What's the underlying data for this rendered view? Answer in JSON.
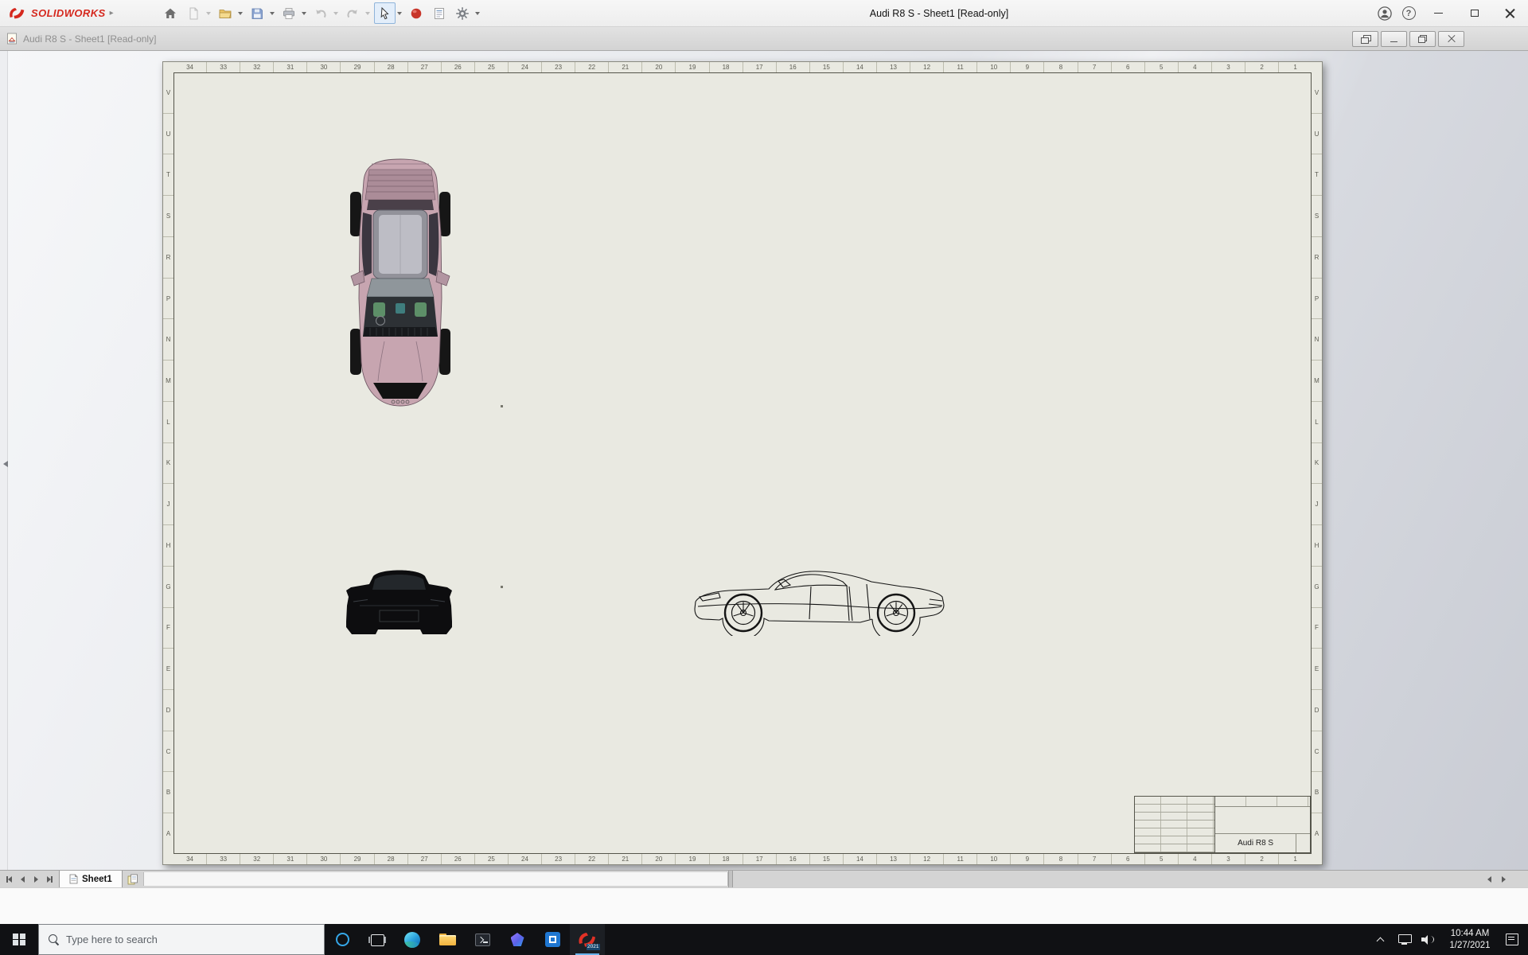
{
  "icons": {
    "brand_chevron": "▸",
    "help_glyph": "?"
  },
  "app": {
    "brand": "SOLIDWORKS",
    "title": "Audi R8 S - Sheet1 [Read-only]"
  },
  "document_window": {
    "title": "Audi R8 S - Sheet1 [Read-only]"
  },
  "drawing": {
    "sheet_name": "Audi R8 S",
    "zone_columns": [
      "34",
      "33",
      "32",
      "31",
      "30",
      "29",
      "28",
      "27",
      "26",
      "25",
      "24",
      "23",
      "22",
      "21",
      "20",
      "19",
      "18",
      "17",
      "16",
      "15",
      "14",
      "13",
      "12",
      "11",
      "10",
      "9",
      "8",
      "7",
      "6",
      "5",
      "4",
      "3",
      "2",
      "1"
    ],
    "zone_rows": [
      "V",
      "U",
      "T",
      "S",
      "R",
      "P",
      "N",
      "M",
      "L",
      "K",
      "J",
      "H",
      "G",
      "F",
      "E",
      "D",
      "C",
      "B",
      "A"
    ],
    "title_block": {
      "part_name": "Audi R8 S"
    }
  },
  "sheet_tabs": {
    "sheet1_label": "Sheet1"
  },
  "taskbar": {
    "search_placeholder": "Type here to search",
    "solidworks_badge": "2021",
    "clock_time": "10:44 AM",
    "clock_date": "1/27/2021"
  },
  "colors": {
    "solidworks_red": "#d5281e",
    "paper": "#e9e9e1",
    "taskbar": "#101114",
    "car_body_pink": "#c7a5b0"
  }
}
